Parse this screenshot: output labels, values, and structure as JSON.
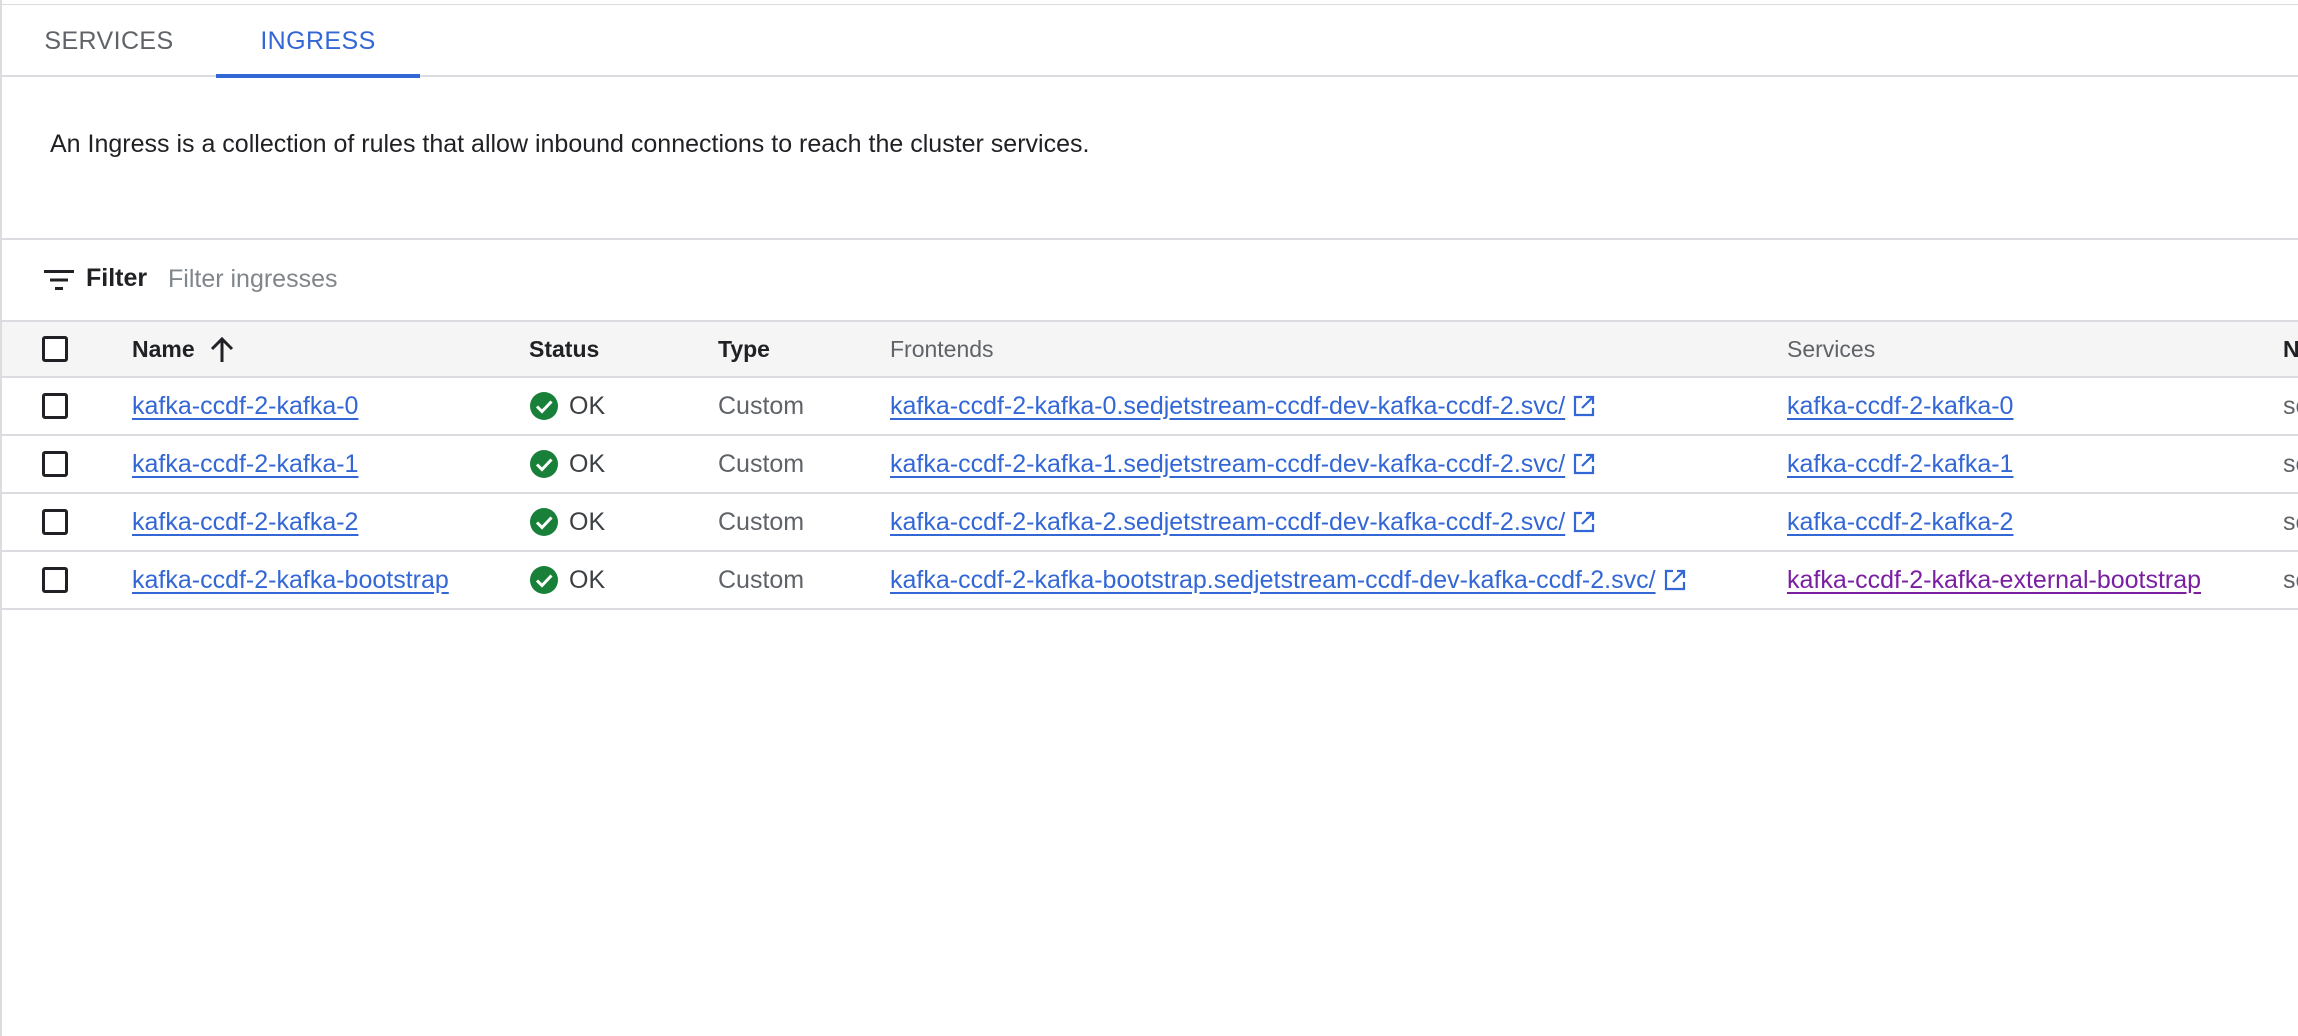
{
  "tabs": [
    {
      "label": "SERVICES",
      "active": false
    },
    {
      "label": "INGRESS",
      "active": true
    }
  ],
  "description": "An Ingress is a collection of rules that allow inbound connections to reach the cluster services.",
  "filter": {
    "label": "Filter",
    "placeholder": "Filter ingresses",
    "icon": "filter-list-icon"
  },
  "table": {
    "columns": {
      "name": "Name",
      "status": "Status",
      "type": "Type",
      "frontends": "Frontends",
      "services": "Services",
      "namespace": "N"
    },
    "sort": {
      "column": "name",
      "direction": "ascending",
      "icon": "arrow-upward-icon"
    },
    "rows": [
      {
        "name": "kafka-ccdf-2-kafka-0",
        "status": "OK",
        "type": "Custom",
        "frontend": "kafka-ccdf-2-kafka-0.sedjetstream-ccdf-dev-kafka-ccdf-2.svc/",
        "service": "kafka-ccdf-2-kafka-0",
        "namespace": "se"
      },
      {
        "name": "kafka-ccdf-2-kafka-1",
        "status": "OK",
        "type": "Custom",
        "frontend": "kafka-ccdf-2-kafka-1.sedjetstream-ccdf-dev-kafka-ccdf-2.svc/",
        "service": "kafka-ccdf-2-kafka-1",
        "namespace": "se"
      },
      {
        "name": "kafka-ccdf-2-kafka-2",
        "status": "OK",
        "type": "Custom",
        "frontend": "kafka-ccdf-2-kafka-2.sedjetstream-ccdf-dev-kafka-ccdf-2.svc/",
        "service": "kafka-ccdf-2-kafka-2",
        "namespace": "se"
      },
      {
        "name": "kafka-ccdf-2-kafka-bootstrap",
        "status": "OK",
        "type": "Custom",
        "frontend": "kafka-ccdf-2-kafka-bootstrap.sedjetstream-ccdf-dev-kafka-ccdf-2.svc/",
        "service": "kafka-ccdf-2-kafka-external-bootstrap",
        "service_visited": true,
        "namespace": "se"
      }
    ]
  },
  "colors": {
    "accent": "#3367d6",
    "visited_link": "#7b1fa2",
    "status_ok": "#188038",
    "divider": "#dadce0",
    "header_bg": "#f5f5f5"
  }
}
